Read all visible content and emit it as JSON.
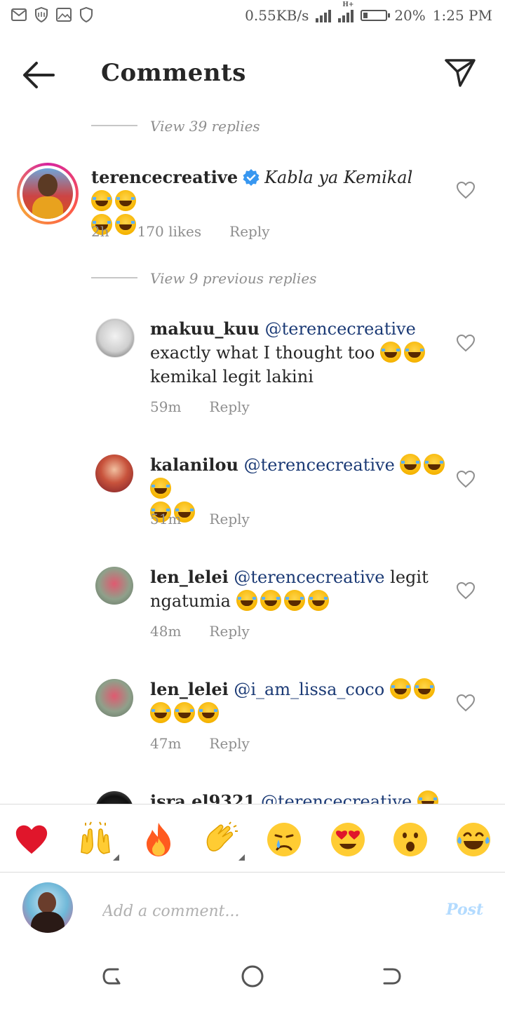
{
  "status_bar": {
    "icons": [
      "gmail-icon",
      "shield-icon",
      "image-icon",
      "shield-outline-icon"
    ],
    "speed": "0.55KB/s",
    "network": "H+",
    "battery_percent": "20%",
    "battery_level": 0.2,
    "time": "1:25 PM"
  },
  "header": {
    "title": "Comments",
    "back_icon": "arrow-left-icon",
    "send_icon": "paper-plane-icon"
  },
  "view_replies_top": "View 39 replies",
  "view_previous": "View 9 previous replies",
  "main_comment": {
    "username": "terencecreative",
    "verified": true,
    "text": "Kabla ya Kemikal",
    "emoji_line1": 2,
    "emoji_line2": 2,
    "time": "2h",
    "likes": "170 likes",
    "reply": "Reply"
  },
  "replies": [
    {
      "username": "makuu_kuu",
      "mention": "@terencecreative",
      "text": "exactly what I thought too",
      "text2": "kemikal legit lakini",
      "time": "59m",
      "reply": "Reply"
    },
    {
      "username": "kalanilou",
      "mention": "@terencecreative",
      "time": "51m",
      "reply": "Reply"
    },
    {
      "username": "len_lelei",
      "mention": "@terencecreative",
      "text": "legit",
      "text2": "ngatumia",
      "time": "48m",
      "reply": "Reply"
    },
    {
      "username": "len_lelei",
      "mention": "@i_am_lissa_coco",
      "time": "47m",
      "reply": "Reply"
    },
    {
      "username": "isra.el9321",
      "mention": "@terencecreative"
    }
  ],
  "reactions": [
    "red-heart-icon",
    "raising-hands-icon",
    "fire-icon",
    "clapping-hands-icon",
    "crying-face-icon",
    "heart-eyes-icon",
    "surprised-face-icon",
    "laughing-tears-icon"
  ],
  "composer": {
    "placeholder": "Add a comment...",
    "post": "Post"
  },
  "nav": [
    "back-nav-icon",
    "home-nav-icon",
    "recents-nav-icon"
  ]
}
